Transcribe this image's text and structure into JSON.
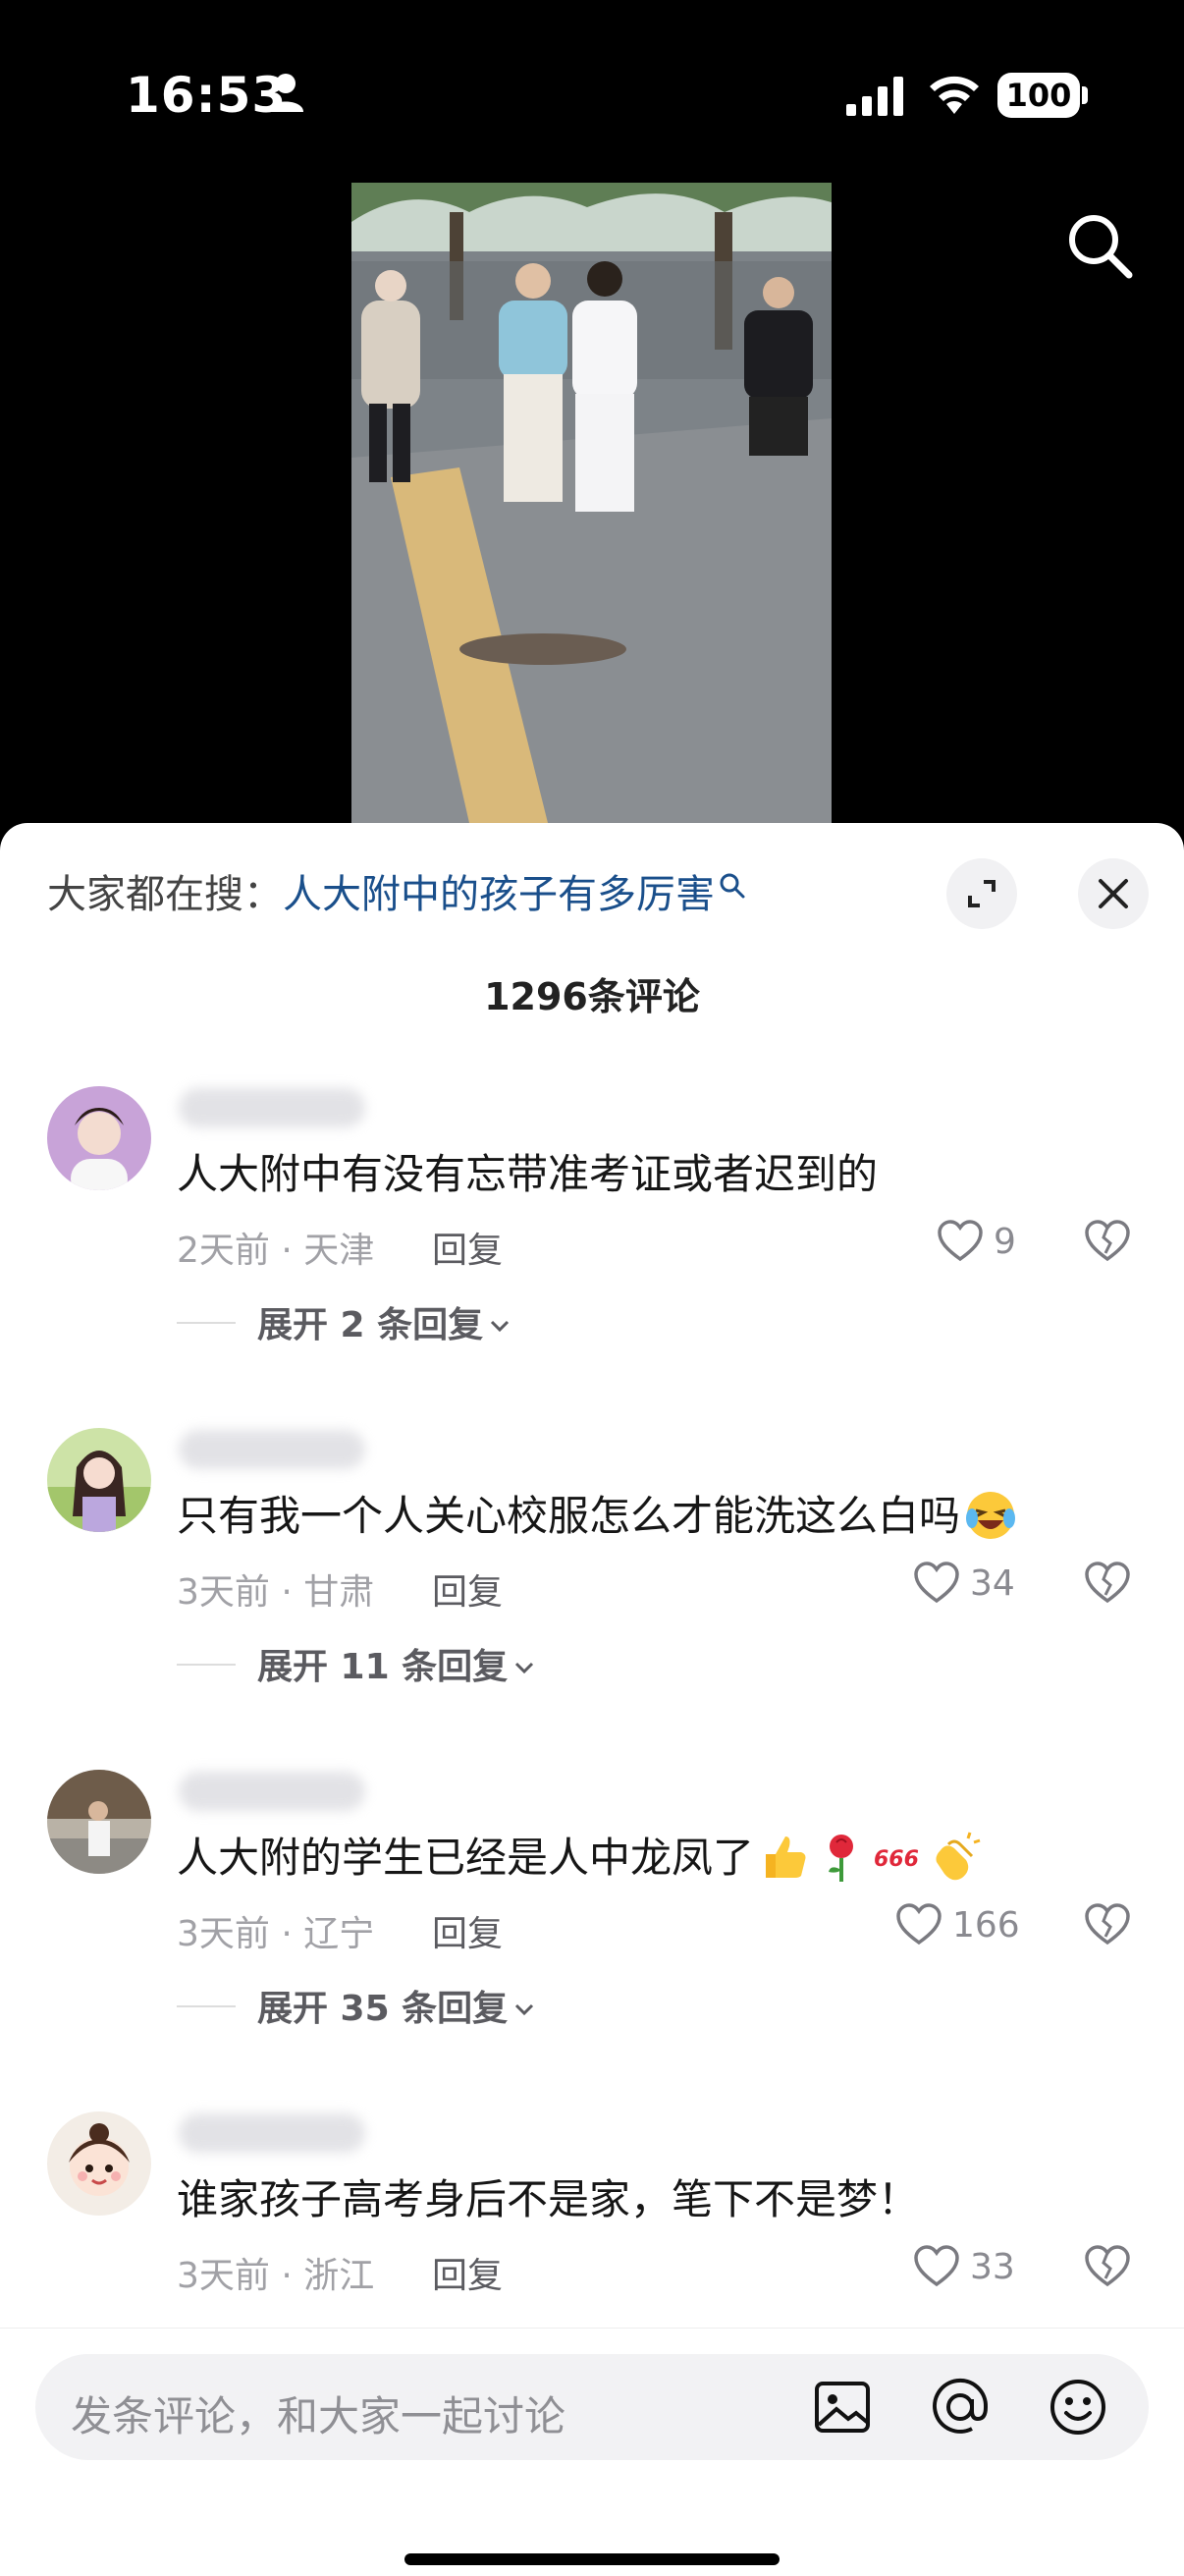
{
  "status_bar": {
    "time": "16:53",
    "battery": "100"
  },
  "hot_search": {
    "prefix": "大家都在搜：",
    "keyword": "人大附中的孩子有多厉害"
  },
  "comment_count": "1296条评论",
  "comments": [
    {
      "text": "人大附中有没有忘带准考证或者迟到的",
      "meta": "2天前 · 天津",
      "reply": "回复",
      "likes": "9",
      "expand": "展开 2 条回复"
    },
    {
      "text": "只有我一个人关心校服怎么才能洗这么白吗",
      "meta": "3天前 · 甘肃",
      "reply": "回复",
      "likes": "34",
      "expand": "展开 11 条回复"
    },
    {
      "text": "人大附的学生已经是人中龙凤了",
      "meta": "3天前 · 辽宁",
      "reply": "回复",
      "likes": "166",
      "expand": "展开 35 条回复"
    },
    {
      "text": "谁家孩子高考身后不是家，笔下不是梦！",
      "meta": "3天前 · 浙江",
      "reply": "回复",
      "likes": "33"
    }
  ],
  "input": {
    "placeholder": "发条评论，和大家一起讨论"
  },
  "colors": {
    "keyword": "#1a4f8b",
    "sheet_bg": "#ffffff",
    "secondary_text": "#a1a1a6"
  }
}
